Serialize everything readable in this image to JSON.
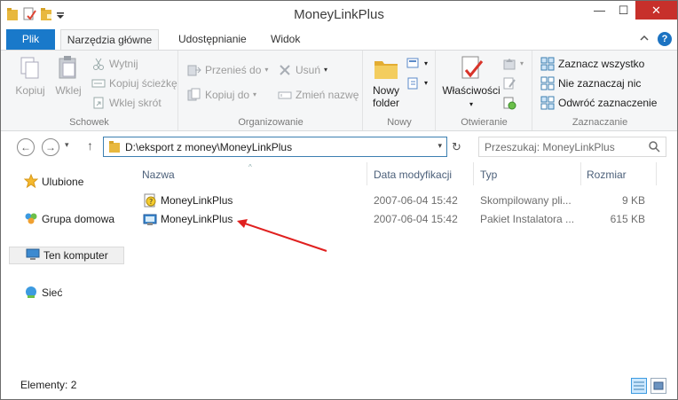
{
  "window": {
    "title": "MoneyLinkPlus"
  },
  "quick_access": {
    "icons": [
      "folder-icon",
      "properties-icon",
      "new-folder-icon",
      "customize-qat-icon"
    ]
  },
  "window_controls": {
    "minimize": "—",
    "maximize": "☐",
    "close": "✕"
  },
  "ribbon_tabs": [
    {
      "label": "Plik"
    },
    {
      "label": "Narzędzia główne"
    },
    {
      "label": "Udostępnianie"
    },
    {
      "label": "Widok"
    }
  ],
  "ribbon": {
    "groups": {
      "clipboard": {
        "label": "Schowek",
        "copy": "Kopiuj",
        "paste": "Wklej",
        "cut": "Wytnij",
        "copy_path": "Kopiuj ścieżkę",
        "paste_shortcut": "Wklej skrót"
      },
      "organize": {
        "label": "Organizowanie",
        "move_to": "Przenieś do",
        "copy_to": "Kopiuj do",
        "delete": "Usuń",
        "rename": "Zmień nazwę"
      },
      "new": {
        "label": "Nowy",
        "new_folder_line1": "Nowy",
        "new_folder_line2": "folder"
      },
      "open": {
        "label": "Otwieranie",
        "properties": "Właściwości"
      },
      "select": {
        "label": "Zaznaczanie",
        "select_all": "Zaznacz wszystko",
        "select_none": "Nie zaznaczaj nic",
        "invert": "Odwróć zaznaczenie"
      }
    }
  },
  "address": {
    "path": "D:\\eksport z money\\MoneyLinkPlus"
  },
  "search": {
    "placeholder": "Przeszukaj: MoneyLinkPlus"
  },
  "nav_pane": {
    "items": [
      {
        "label": "Ulubione",
        "icon": "star-icon"
      },
      {
        "label": "Grupa domowa",
        "icon": "homegroup-icon"
      },
      {
        "label": "Ten komputer",
        "icon": "computer-icon",
        "selected": true
      },
      {
        "label": "Sieć",
        "icon": "network-icon"
      }
    ]
  },
  "columns": {
    "name": "Nazwa",
    "date": "Data modyfikacji",
    "type": "Typ",
    "size": "Rozmiar"
  },
  "files": [
    {
      "name": "MoneyLinkPlus",
      "date": "2007-06-04 15:42",
      "type": "Skompilowany pli...",
      "size": "9 KB",
      "icon": "help-file-icon"
    },
    {
      "name": "MoneyLinkPlus",
      "date": "2007-06-04 15:42",
      "type": "Pakiet Instalatora ...",
      "size": "615 KB",
      "icon": "installer-icon"
    }
  ],
  "status": {
    "items_count": "Elementy: 2"
  },
  "colors": {
    "accent": "#1979ca",
    "arrow": "#e0201f",
    "close": "#c7302b"
  }
}
